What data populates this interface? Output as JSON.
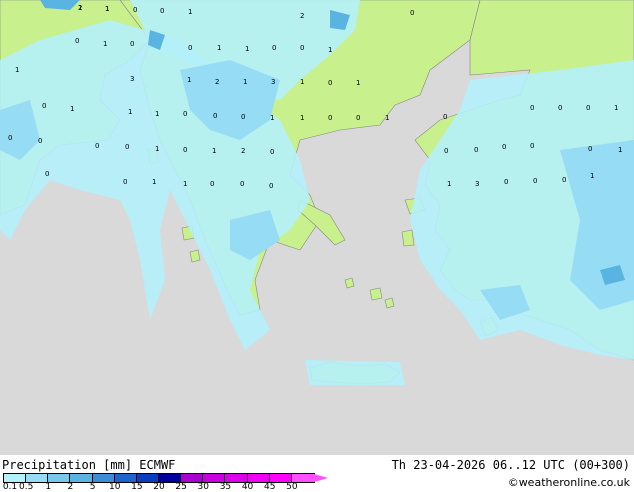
{
  "title": "Precipitation [mm]  ECMWF",
  "datetime": "Th 23-04-2026 06..12 UTC (00+300)",
  "credit": "©weatheronline.co.uk",
  "legend": {
    "ticks": [
      "0.1",
      "0.5",
      "1",
      "2",
      "5",
      "10",
      "15",
      "20",
      "25",
      "30",
      "35",
      "40",
      "45",
      "50"
    ],
    "colors": [
      "#b4f0fa",
      "#96dcf5",
      "#78c8eb",
      "#5ab4e1",
      "#3c8cd7",
      "#1e64cd",
      "#0a3cbe",
      "#0000a0",
      "#aa00d2",
      "#c800e1",
      "#dc00eb",
      "#f000f5",
      "#ff00ff",
      "#ff50ff"
    ]
  },
  "colors": {
    "sea": "#d9d9d9",
    "land": "#c8f08c",
    "precip_light": "#b4f0fa",
    "precip_medium": "#96dcf5",
    "precip_heavy": "#5ab4e1"
  },
  "map_values": [
    "1",
    "1",
    "0",
    "0",
    "1",
    "2",
    "0",
    "0",
    "1",
    "0",
    "0",
    "1",
    "1",
    "0",
    "0",
    "1",
    "1",
    "3",
    "1",
    "2",
    "1",
    "3",
    "1",
    "0",
    "1",
    "0",
    "1",
    "1",
    "1",
    "0",
    "0",
    "0",
    "1",
    "1",
    "0",
    "0",
    "1",
    "0",
    "0",
    "0",
    "0",
    "1",
    "0",
    "0",
    "0",
    "0",
    "1",
    "0",
    "1",
    "2",
    "0",
    "0",
    "0",
    "0",
    "0",
    "0",
    "1",
    "0",
    "0",
    "1",
    "1",
    "0",
    "0",
    "0",
    "1",
    "3",
    "0",
    "0",
    "0",
    "1",
    "2",
    "1"
  ]
}
